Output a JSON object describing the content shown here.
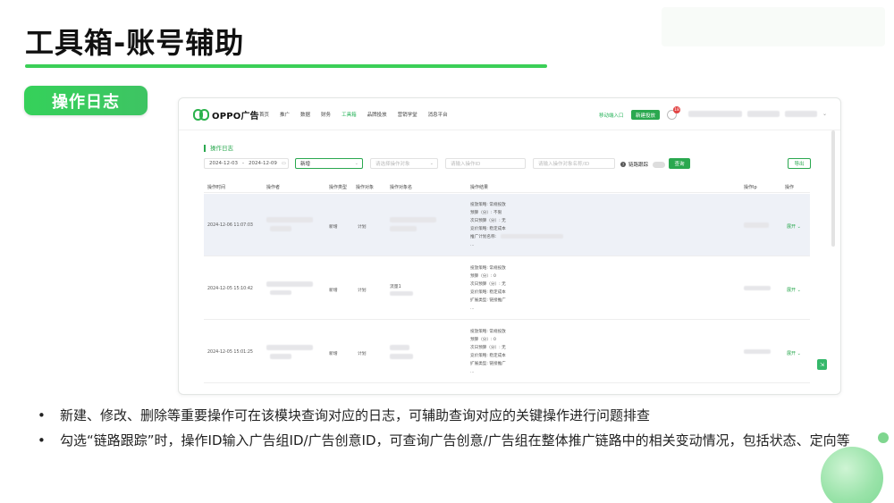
{
  "slide": {
    "title": "工具箱-账号辅助",
    "section_label": "操作日志",
    "bullets": [
      "新建、修改、删除等重要操作可在该模块查询对应的日志，可辅助查询对应的关键操作进行问题排查",
      "勾选“链路跟踪”时，操作ID输入广告组ID/广告创意ID，可查询广告创意/广告组在整体推广链路中的相关变动情况，包括状态、定向等"
    ],
    "bullet_marker": "•"
  },
  "app": {
    "brand": "OPPO广告",
    "nav": [
      "首页",
      "推广",
      "数据",
      "财务",
      "工具箱",
      "品牌投放",
      "营销学堂",
      "消息平台"
    ],
    "active_nav": "工具箱",
    "mobile_entry": "移动端入口",
    "new_button": "新建投放",
    "notification_count": "18",
    "accent_color": "#2aa84f"
  },
  "log_panel": {
    "title": "操作日志",
    "date_start": "2024-12-03",
    "date_sep": "-",
    "date_end": "2024-12-09",
    "type_select_value": "新增",
    "object_placeholder": "请选择操作对象",
    "id_placeholder": "请输入操作ID",
    "name_placeholder": "请输入操作对象名称/ID",
    "trace_label": "链路跟踪",
    "query_button": "查询",
    "export_button": "导出",
    "columns": [
      "操作时间",
      "操作者",
      "操作类型",
      "操作对象",
      "操作对象名",
      "操作结果",
      "操作Ip",
      "操作"
    ],
    "rows": [
      {
        "time": "2024-12-06 11:07:03",
        "type": "新增",
        "object": "计划",
        "object_name": "",
        "results": [
          "投放策略: 常规投放",
          "预算（分）: 不限",
          "次日预算（分）: 无",
          "竞价策略: 稳定成本",
          "推广计划名称:"
        ],
        "ellipsis": "...",
        "action": "展开"
      },
      {
        "time": "2024-12-05 15:10:42",
        "type": "新增",
        "object": "计划",
        "object_name": "流量1",
        "results": [
          "投放策略: 常规投放",
          "预算（分）: 0",
          "次日预算（分）: 无",
          "竞价策略: 稳定成本",
          "扩展类型: 链接推广"
        ],
        "ellipsis": "...",
        "action": "展开"
      },
      {
        "time": "2024-12-05 15:01:25",
        "type": "新增",
        "object": "计划",
        "object_name": "",
        "results": [
          "投放策略: 常规投放",
          "预算（分）: 0",
          "次日预算（分）: 无",
          "竞价策略: 稳定成本",
          "扩展类型: 链接推广"
        ],
        "ellipsis": "...",
        "action": "展开"
      }
    ]
  }
}
